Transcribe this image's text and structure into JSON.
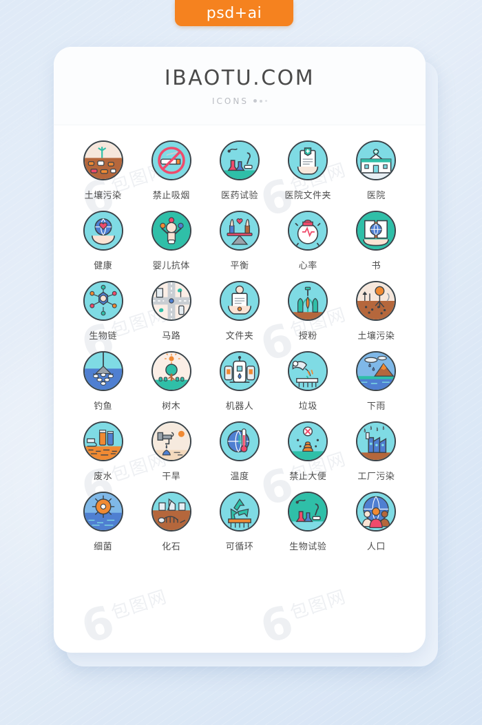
{
  "badge": {
    "label": "psd+ai",
    "color": "#f5821f"
  },
  "card": {
    "header": {
      "title": "IBAOTU.COM",
      "subtitle": "ICONS"
    },
    "watermark_text": "包图网"
  },
  "palette": {
    "background_start": "#dfeaf7",
    "background_end": "#d7e5f5",
    "card_bg": "#ffffff",
    "card_back_bg": "#eaf1fa",
    "title_color": "#4a4a4a",
    "subtitle_color": "#b9bcc2",
    "label_color": "#4c4c4c",
    "icon_outline": "#3b4349",
    "icon_cyan": "#7fdbe4",
    "icon_teal": "#2fbfa8",
    "icon_brown": "#b5673c",
    "icon_sand": "#f6e7dc",
    "icon_blue": "#4f7fd1",
    "icon_orange": "#f08a33",
    "icon_red": "#ef4b6b",
    "icon_grey": "#9aa3ab"
  },
  "icons": [
    {
      "label": "土壤污染",
      "name": "soil-pollution",
      "theme": "brown"
    },
    {
      "label": "禁止吸烟",
      "name": "no-smoking",
      "theme": "cyan"
    },
    {
      "label": "医药试验",
      "name": "medical-experiment",
      "theme": "cyan"
    },
    {
      "label": "医院文件夹",
      "name": "hospital-folder",
      "theme": "cyan"
    },
    {
      "label": "医院",
      "name": "hospital",
      "theme": "cyan"
    },
    {
      "label": "健康",
      "name": "health",
      "theme": "cyan"
    },
    {
      "label": "婴儿抗体",
      "name": "baby-antibody",
      "theme": "teal"
    },
    {
      "label": "平衡",
      "name": "balance",
      "theme": "cyan"
    },
    {
      "label": "心率",
      "name": "heart-rate",
      "theme": "cyan"
    },
    {
      "label": "书",
      "name": "book",
      "theme": "teal"
    },
    {
      "label": "生物链",
      "name": "biological-chain",
      "theme": "cyan"
    },
    {
      "label": "马路",
      "name": "road",
      "theme": "sand"
    },
    {
      "label": "文件夹",
      "name": "folder",
      "theme": "cyan"
    },
    {
      "label": "授粉",
      "name": "pollination",
      "theme": "cyan"
    },
    {
      "label": "土壤污染",
      "name": "soil-pollution-2",
      "theme": "brown"
    },
    {
      "label": "钓鱼",
      "name": "fishing",
      "theme": "blue"
    },
    {
      "label": "树木",
      "name": "trees",
      "theme": "sand"
    },
    {
      "label": "机器人",
      "name": "robot",
      "theme": "cyan"
    },
    {
      "label": "垃圾",
      "name": "garbage",
      "theme": "cyan"
    },
    {
      "label": "下雨",
      "name": "rain",
      "theme": "blue"
    },
    {
      "label": "废水",
      "name": "wastewater",
      "theme": "orange"
    },
    {
      "label": "干旱",
      "name": "drought",
      "theme": "sand"
    },
    {
      "label": "温度",
      "name": "temperature",
      "theme": "cyan"
    },
    {
      "label": "禁止大便",
      "name": "no-defecation",
      "theme": "cyan"
    },
    {
      "label": "工厂污染",
      "name": "factory-pollution",
      "theme": "cyan"
    },
    {
      "label": "细菌",
      "name": "bacteria",
      "theme": "blue"
    },
    {
      "label": "化石",
      "name": "fossil",
      "theme": "brown"
    },
    {
      "label": "可循环",
      "name": "recyclable",
      "theme": "cyan"
    },
    {
      "label": "生物试验",
      "name": "biology-experiment",
      "theme": "teal"
    },
    {
      "label": "人口",
      "name": "population",
      "theme": "cyan"
    }
  ]
}
